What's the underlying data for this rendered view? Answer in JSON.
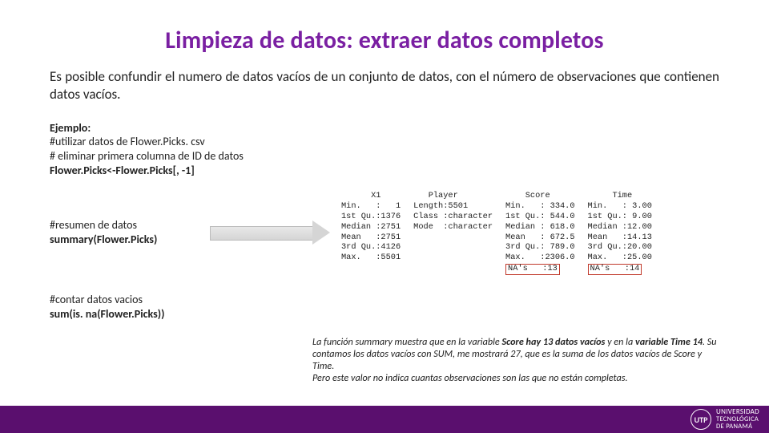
{
  "title": "Limpieza de datos: extraer datos completos",
  "intro": "Es posible confundir el numero de datos vacíos de un conjunto de datos, con el número de observaciones que contienen datos vacíos.",
  "example": {
    "heading": "Ejemplo:",
    "l1": "#utilizar datos de  Flower.Picks. csv",
    "l2": "# eliminar primera columna de ID de datos",
    "l3": "Flower.Picks<-Flower.Picks[, -1]"
  },
  "summary_block": {
    "l1": "#resumen de datos",
    "l2": "summary(Flower.Picks)"
  },
  "count_block": {
    "l1": "#contar datos vacios",
    "l2": "sum(is. na(Flower.Picks))"
  },
  "summary_output": {
    "x1": {
      "header": "      X1",
      "lines": [
        "Min.   :   1",
        "1st Qu.:1376",
        "Median :2751",
        "Mean   :2751",
        "3rd Qu.:4126",
        "Max.   :5501"
      ]
    },
    "player": {
      "header": "   Player",
      "lines": [
        "Length:5501",
        "Class :character",
        "Mode  :character"
      ]
    },
    "score": {
      "header": "    Score",
      "lines": [
        "Min.   : 334.0",
        "1st Qu.: 544.0",
        "Median : 618.0",
        "Mean   : 672.5",
        "3rd Qu.: 789.0",
        "Max.   :2306.0"
      ],
      "na": "NA's   :13"
    },
    "time": {
      "header": "     Time",
      "lines": [
        "Min.   : 3.00",
        "1st Qu.: 9.00",
        "Median :12.00",
        "Mean   :14.13",
        "3rd Qu.:20.00",
        "Max.   :25.00"
      ],
      "na": "NA's   :14"
    }
  },
  "note": {
    "t1": "La función summary  muestra que en la variable ",
    "t2": "Score hay 13 datos vacíos",
    "t3": " y en la ",
    "t4": "variable Time 14",
    "t5": ". Su contamos los datos vacíos con SUM, me mostrará 27, que es la suma de los datos vacíos de Score y Time.",
    "t6": "Pero este valor no indica cuantas observaciones son las que no están completas."
  },
  "footer": {
    "seal": "UTP",
    "l1": "UNIVERSIDAD",
    "l2": "TECNOLÓGICA",
    "l3": "DE PANAMÁ"
  }
}
